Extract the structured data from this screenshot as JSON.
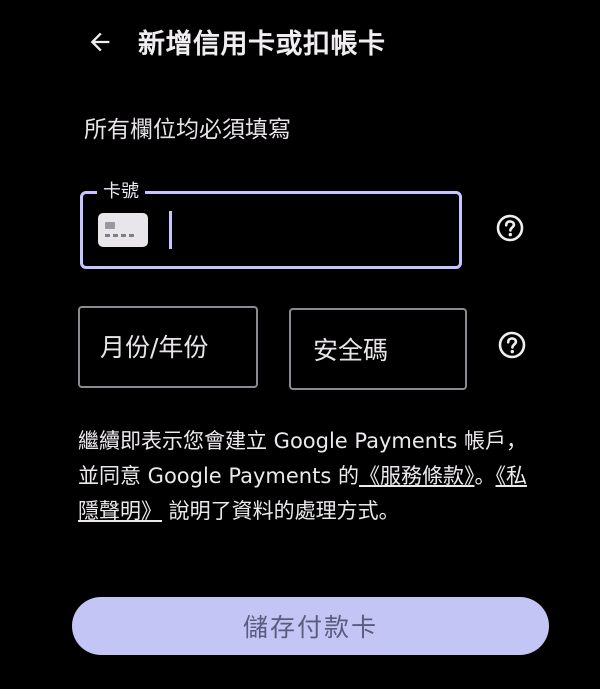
{
  "header": {
    "back_icon": "arrow-back-icon",
    "title": "新增信用卡或扣帳卡"
  },
  "form": {
    "required_note": "所有欄位均必須填寫",
    "card_number": {
      "label": "卡號",
      "value": "",
      "icon": "credit-card-icon",
      "help_icon": "help-circle-icon"
    },
    "expiry": {
      "label": "月份/年份",
      "value": ""
    },
    "cvc": {
      "label": "安全碼",
      "value": "",
      "help_icon": "help-circle-icon"
    }
  },
  "terms": {
    "text_before": "繼續即表示您會建立 Google Payments 帳戶，並同意 Google Payments 的",
    "link_tos": "《服務條款》",
    "separator": "。",
    "link_privacy": "《私隱聲明》",
    "text_after": " 說明了資料的處理方式。"
  },
  "actions": {
    "save_label": "儲存付款卡"
  },
  "colors": {
    "background": "#000000",
    "accent": "#c4c6ff",
    "button_bg": "#c3c5f4",
    "button_text": "#5b5c80",
    "text": "#e9e6ea",
    "outline": "#8c8a90"
  }
}
